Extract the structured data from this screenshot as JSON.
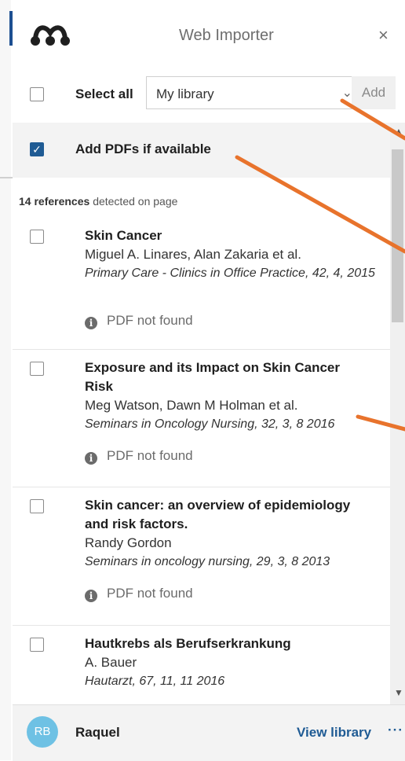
{
  "header": {
    "title": "Web Importer",
    "close_glyph": "×",
    "logo_icon": "mendeley-logo-icon"
  },
  "select_bar": {
    "select_all_label": "Select all",
    "library_value": "My library",
    "chevron_glyph": "⌄",
    "add_label": "Add"
  },
  "pdf_bar": {
    "label": "Add PDFs if available",
    "checked": true
  },
  "detected": {
    "count": "14 references",
    "suffix": "detected on page"
  },
  "references": [
    {
      "title": "Skin Cancer",
      "authors": "Miguel A. Linares, Alan Zakaria et al.",
      "journal": "Primary Care - Clinics in Office Practice, 42, 4, 2015",
      "pdf_status": "PDF not found"
    },
    {
      "title": "Exposure and its Impact on Skin Cancer Risk",
      "authors": "Meg Watson, Dawn M Holman et al.",
      "journal": "Seminars in Oncology Nursing, 32, 3, 8 2016",
      "pdf_status": "PDF not found"
    },
    {
      "title": "Skin cancer: an overview of epidemiology and risk factors.",
      "authors": "Randy Gordon",
      "journal": "Seminars in oncology nursing, 29, 3, 8 2013",
      "pdf_status": "PDF not found"
    },
    {
      "title": "Hautkrebs als Berufserkrankung",
      "authors": "A. Bauer",
      "journal": "Hautarzt, 67, 11, 11 2016",
      "pdf_status": ""
    }
  ],
  "info_glyph": "i",
  "footer": {
    "avatar_initials": "RB",
    "username": "Raquel",
    "view_library": "View library",
    "more_glyph": "···"
  },
  "colors": {
    "accent_blue": "#1f5b94",
    "avatar": "#6ec1e4",
    "annotation_arrow": "#e8732c"
  }
}
